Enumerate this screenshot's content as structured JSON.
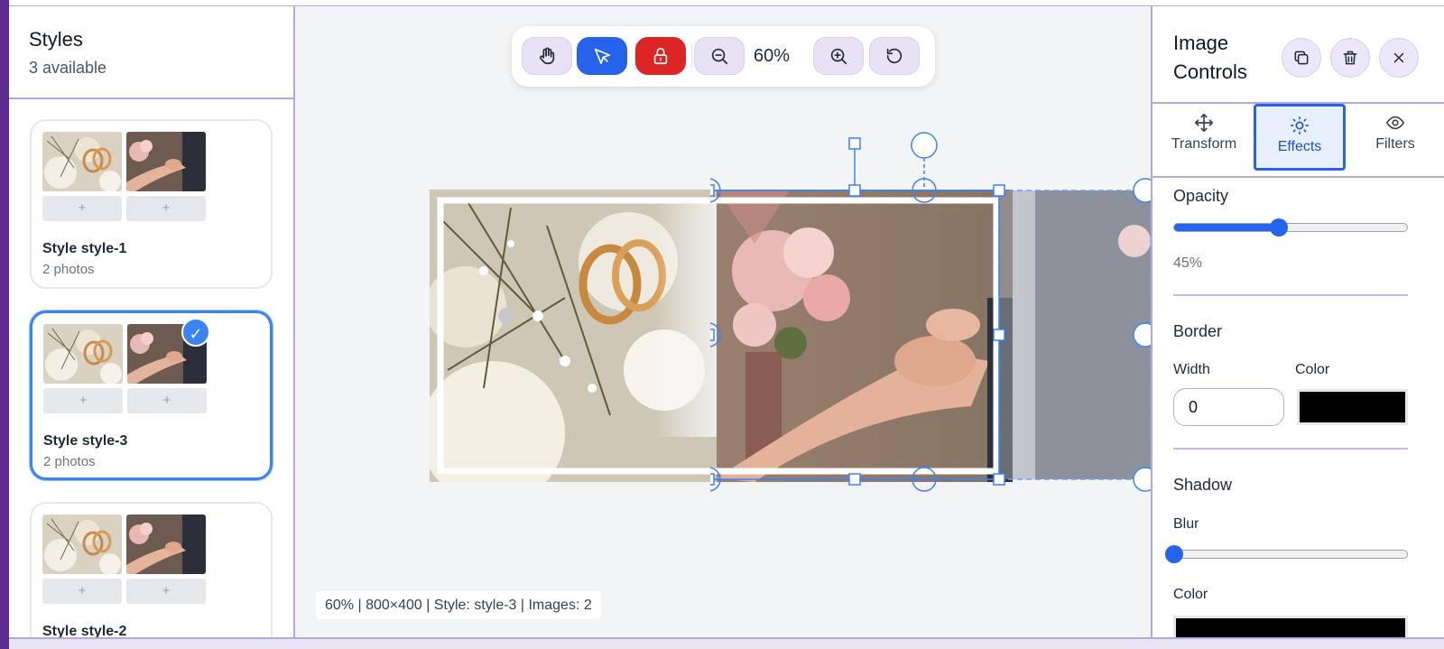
{
  "styles_panel": {
    "title": "Styles",
    "subtitle": "3 available",
    "cards": [
      {
        "name": "Style style-1",
        "count": "2 photos",
        "add1": "+",
        "add2": "+",
        "selected": false
      },
      {
        "name": "Style style-3",
        "count": "2 photos",
        "add1": "+",
        "add2": "+",
        "selected": true
      },
      {
        "name": "Style style-2",
        "count": "",
        "add1": "+",
        "add2": "+",
        "selected": false
      }
    ]
  },
  "toolbar": {
    "zoom": "60%",
    "tools": [
      "hand-icon",
      "pointer-icon",
      "lock-icon",
      "zoom-out-icon",
      "zoom-in-icon",
      "reset-icon"
    ]
  },
  "status": "60% | 800×400 | Style: style-3 | Images: 2",
  "controls": {
    "title": "Image Controls",
    "tabs": [
      {
        "label": "Transform",
        "icon": "move-icon"
      },
      {
        "label": "Effects",
        "icon": "sun-icon"
      },
      {
        "label": "Filters",
        "icon": "eye-icon"
      }
    ],
    "opacity": {
      "label": "Opacity",
      "value": "45%",
      "level": 0.45
    },
    "border": {
      "label": "Border",
      "width_label": "Width",
      "width_value": "0",
      "color_label": "Color",
      "color": "#000000"
    },
    "shadow": {
      "label": "Shadow",
      "blur_label": "Blur",
      "blur_level": 0,
      "color_label": "Color",
      "color": "#000000"
    }
  },
  "colors": {
    "accent": "#2563eb",
    "danger": "#dc2626",
    "frame": "#b9a6dc"
  }
}
